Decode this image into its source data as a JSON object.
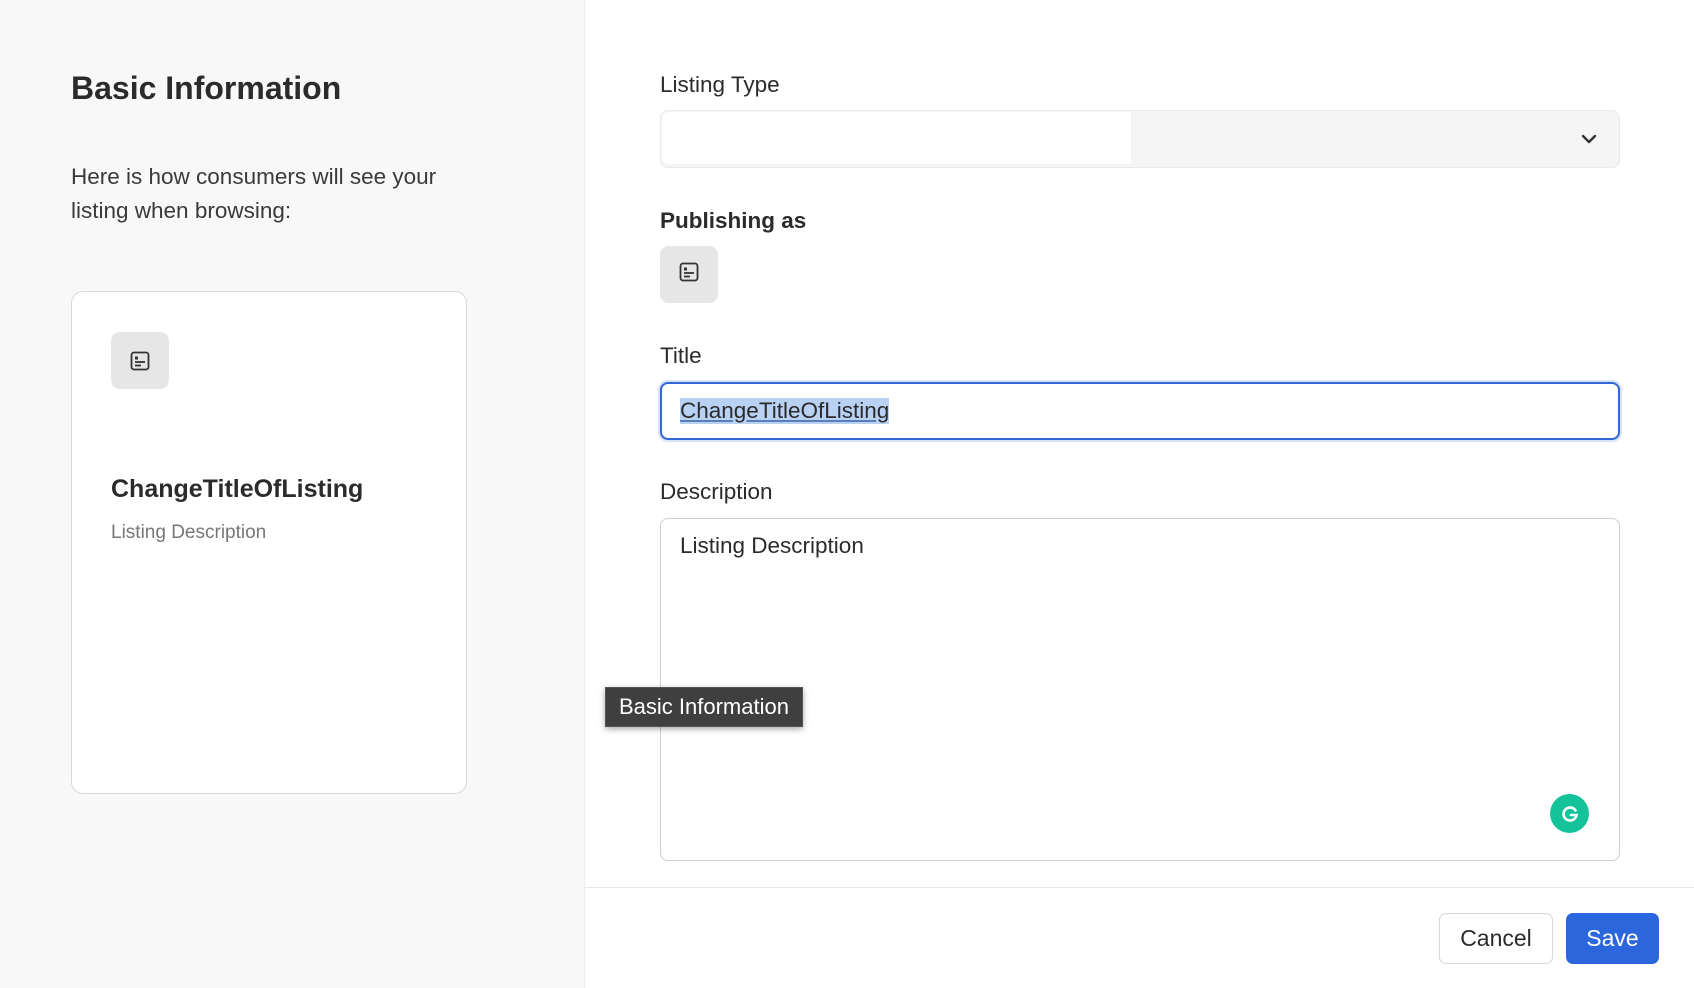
{
  "left_panel": {
    "heading": "Basic Information",
    "intro": "Here is how consumers will see your listing when browsing:",
    "preview": {
      "icon": "listing-doc-icon",
      "title": "ChangeTitleOfListing",
      "description": "Listing Description"
    }
  },
  "form": {
    "listing_type": {
      "label": "Listing Type",
      "value": ""
    },
    "publishing_as": {
      "label": "Publishing as",
      "icon": "listing-doc-icon"
    },
    "title": {
      "label": "Title",
      "value": "ChangeTitleOfListing"
    },
    "description": {
      "label": "Description",
      "value": "Listing Description"
    }
  },
  "tooltip": "Basic Information",
  "footer": {
    "cancel_label": "Cancel",
    "save_label": "Save"
  },
  "colors": {
    "primary": "#2c66dd",
    "selection": "#b9d1f3",
    "grammarly": "#15c39a"
  }
}
